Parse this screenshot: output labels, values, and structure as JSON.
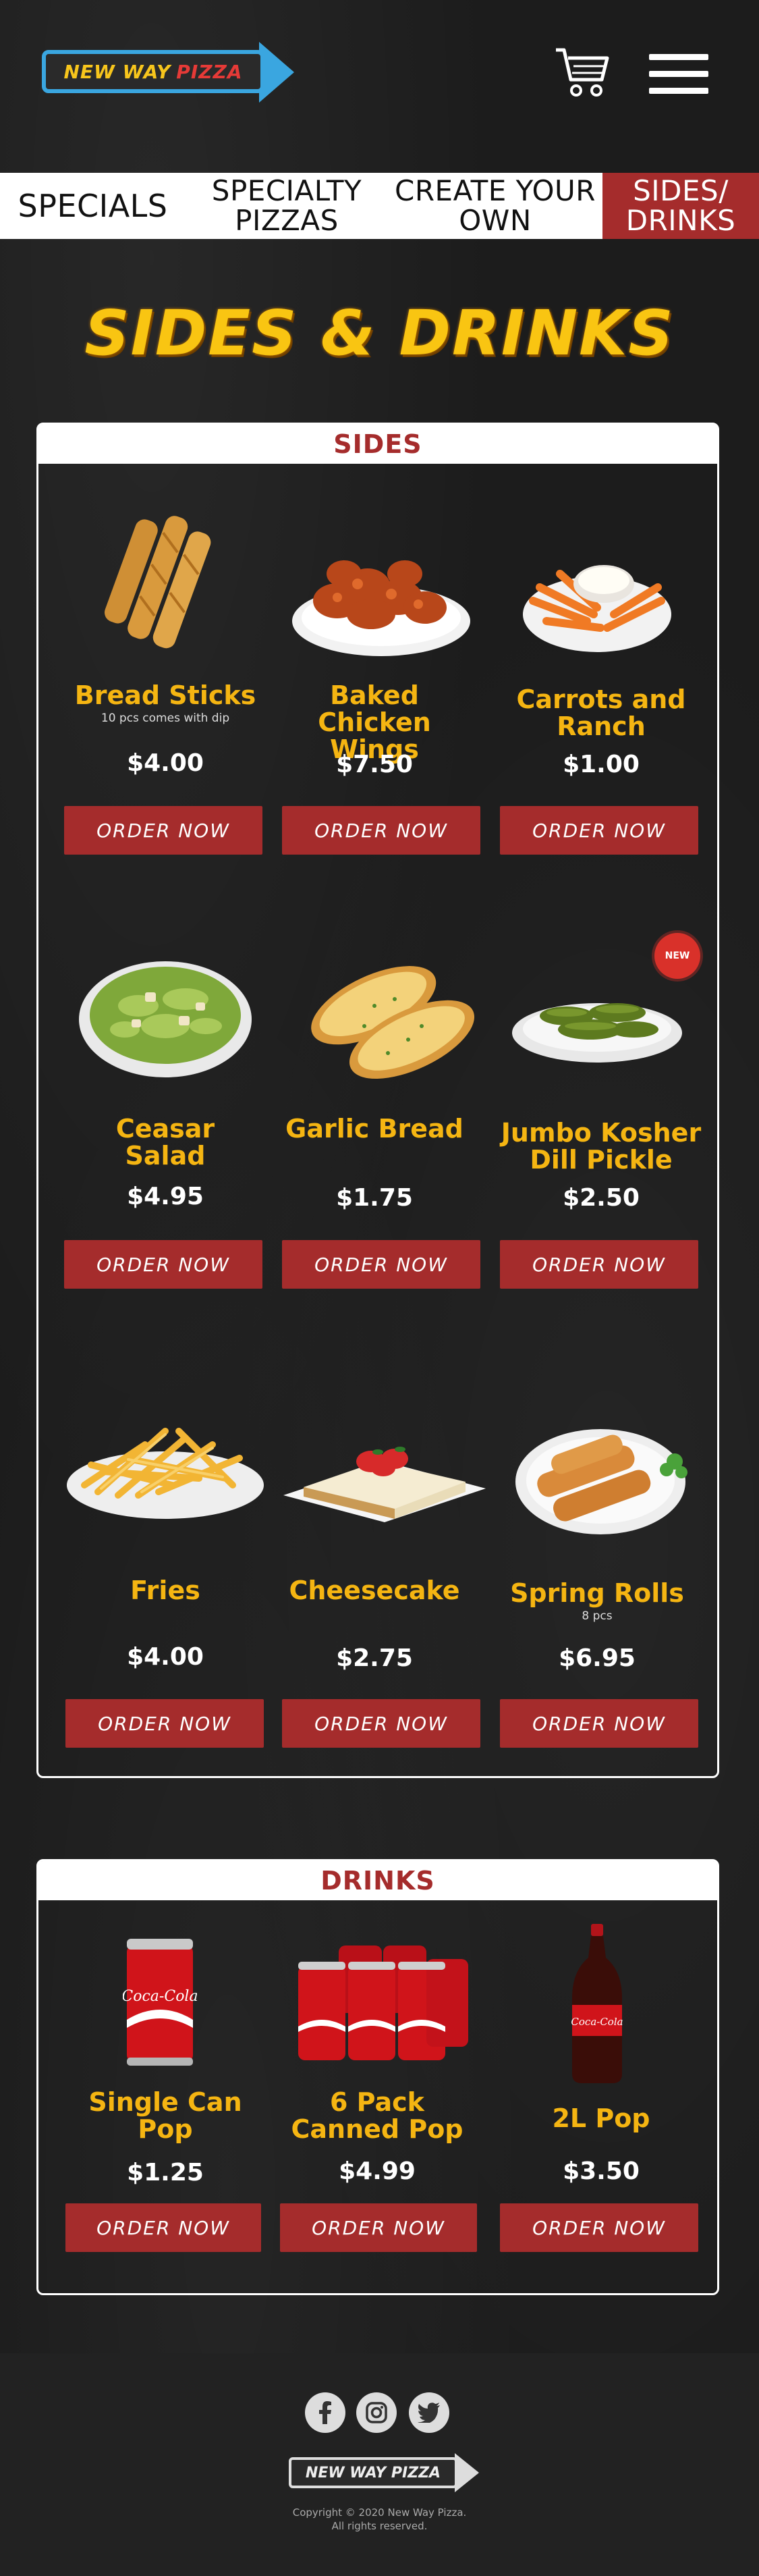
{
  "header": {
    "logo": {
      "word1": "NEW WAY",
      "word2": "PIZZA"
    },
    "cart_icon": "shopping-cart-icon",
    "menu_icon": "hamburger-menu-icon"
  },
  "nav": {
    "items": [
      {
        "label": "SPECIALS"
      },
      {
        "label_line1": "SPECIALTY",
        "label_line2": "PIZZAS"
      },
      {
        "label_line1": "CREATE YOUR",
        "label_line2": "OWN"
      },
      {
        "label_line1": "SIDES/",
        "label_line2": "DRINKS",
        "active": true
      }
    ]
  },
  "page_title": "SIDES & DRINKS",
  "sides": {
    "heading": "SIDES",
    "items": [
      {
        "name_line1": "Bread Sticks",
        "name_line2": "",
        "desc": "10 pcs comes with dip",
        "price": "$4.00",
        "button": "ORDER NOW"
      },
      {
        "name_line1": "Baked",
        "name_line2": "Chicken Wings",
        "desc": "",
        "price": "$7.50",
        "button": "ORDER NOW"
      },
      {
        "name_line1": "Carrots and",
        "name_line2": "Ranch",
        "desc": "",
        "price": "$1.00",
        "button": "ORDER NOW"
      },
      {
        "name_line1": "Ceasar",
        "name_line2": "Salad",
        "desc": "",
        "price": "$4.95",
        "button": "ORDER NOW"
      },
      {
        "name_line1": "Garlic Bread",
        "name_line2": "",
        "desc": "",
        "price": "$1.75",
        "button": "ORDER NOW"
      },
      {
        "name_line1": "Jumbo Kosher",
        "name_line2": "Dill Pickle",
        "desc": "",
        "price": "$2.50",
        "button": "ORDER NOW",
        "badge": "NEW"
      },
      {
        "name_line1": "Fries",
        "name_line2": "",
        "desc": "",
        "price": "$4.00",
        "button": "ORDER NOW"
      },
      {
        "name_line1": "Cheesecake",
        "name_line2": "",
        "desc": "",
        "price": "$2.75",
        "button": "ORDER NOW"
      },
      {
        "name_line1": "Spring Rolls",
        "name_line2": "",
        "desc": "8 pcs",
        "price": "$6.95",
        "button": "ORDER NOW"
      }
    ]
  },
  "drinks": {
    "heading": "DRINKS",
    "items": [
      {
        "name_line1": "Single Can",
        "name_line2": "Pop",
        "price": "$1.25",
        "button": "ORDER NOW"
      },
      {
        "name_line1": "6 Pack",
        "name_line2": "Canned Pop",
        "price": "$4.99",
        "button": "ORDER NOW"
      },
      {
        "name_line1": "2L Pop",
        "name_line2": "",
        "price": "$3.50",
        "button": "ORDER NOW"
      }
    ]
  },
  "footer": {
    "social": [
      "facebook-icon",
      "instagram-icon",
      "twitter-icon"
    ],
    "logo_text": "NEW WAY PIZZA",
    "copyright_line1": "Copyright © 2020 New Way Pizza.",
    "copyright_line2": "All rights reserved."
  },
  "colors": {
    "accent_red": "#a52c2c",
    "title_yellow": "#f9c512",
    "item_name_gold": "#f5b512",
    "logo_blue": "#3aa6e0"
  }
}
